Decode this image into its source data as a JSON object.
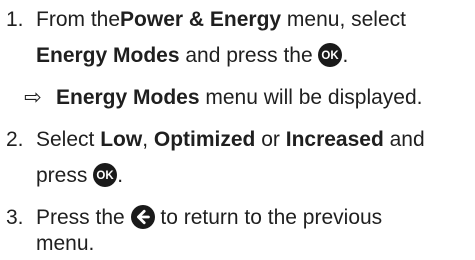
{
  "steps": [
    {
      "number": "1.",
      "line1": {
        "a": "From the",
        "b": "Power & Energy",
        "c": " menu, select"
      },
      "line2": {
        "a": "Energy Modes",
        "b": " and press the ",
        "c": "."
      },
      "ok_icon": "ok-button-icon"
    },
    {
      "result_arrow": "⇨",
      "line1": {
        "a": "Energy Modes",
        "b": " menu will be displayed."
      }
    },
    {
      "number": "2.",
      "line1": {
        "a": "Select ",
        "b": "Low",
        "c": ", ",
        "d": "Optimized",
        "e": " or ",
        "f": "Increased",
        "g": " and"
      },
      "line2": {
        "a": "press ",
        "b": "."
      },
      "ok_icon": "ok-button-icon"
    },
    {
      "number": "3.",
      "line1": {
        "a": "Press the ",
        "b": " to return to the previous"
      },
      "line2": {
        "a": "menu."
      },
      "back_icon": "back-arrow-icon"
    }
  ],
  "icon_labels": {
    "ok": "OK"
  },
  "colors": {
    "text": "#1f1f1f",
    "icon": "#1a1a1a",
    "icon_fg": "#ffffff"
  }
}
